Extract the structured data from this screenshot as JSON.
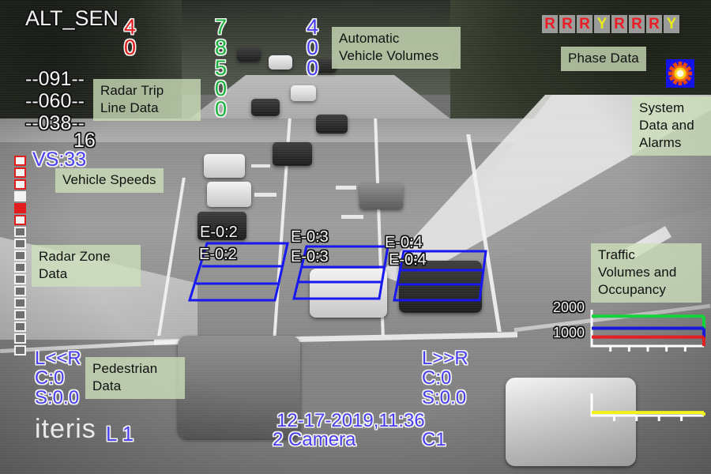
{
  "header": {
    "sensor_name": "ALT_SEN",
    "brand": "iteris"
  },
  "radar_trip_line": {
    "label": "Radar Trip\nLine Data",
    "values": [
      "--091--",
      "--060--",
      "--038--"
    ],
    "extra_count": "16"
  },
  "vehicle_speeds": {
    "label": "Vehicle Speeds",
    "value": "VS:33"
  },
  "radar_zone": {
    "label": "Radar Zone\nData",
    "states": [
      "red-open",
      "red-open",
      "red-open",
      "white",
      "red-fill",
      "red-open",
      "gray",
      "gray",
      "gray",
      "gray",
      "gray",
      "gray",
      "gray",
      "gray",
      "gray",
      "gray",
      "gray"
    ]
  },
  "automatic_vehicle_volumes": {
    "label": "Automatic\nVehicle Volumes",
    "columns": [
      {
        "color": "#e01b1b",
        "digits": [
          "4",
          "0"
        ]
      },
      {
        "color": "#17b23a",
        "digits": [
          "7",
          "8",
          "5",
          "0",
          "0"
        ]
      },
      {
        "color": "#4a3ff0",
        "digits": [
          "4",
          "0",
          "0"
        ]
      }
    ]
  },
  "phase_data": {
    "label": "Phase Data",
    "phases": [
      "R",
      "R",
      "R",
      "Y",
      "R",
      "R",
      "R",
      "Y"
    ]
  },
  "system_data": {
    "label": "System\nData and\nAlarms",
    "alarm_icon": "sun-alarm-icon"
  },
  "detection_zones": {
    "zones": [
      {
        "top_label": "E-0:2",
        "inner_label": "E-0:2"
      },
      {
        "top_label": "E-0:3",
        "inner_label": "E-0:3"
      },
      {
        "top_label": "E-0:4",
        "inner_label": "E-0:4"
      }
    ]
  },
  "pedestrian_left": {
    "label": "Pedestrian\nData",
    "direction": "L<<R",
    "count": "C:0",
    "speed": "S:0.0"
  },
  "pedestrian_right": {
    "direction": "L>>R",
    "count": "C:0",
    "speed": "S:0.0"
  },
  "footer": {
    "timestamp": "12-17-2019,11:36",
    "camera": "2 Camera",
    "channel": "C1",
    "lane": "L 1"
  },
  "traffic_panel": {
    "label": "Traffic\nVolumes and\nOccupancy"
  },
  "chart_data": [
    {
      "type": "line",
      "title": "Traffic Volumes and Occupancy",
      "ytick_labels": [
        "2000",
        "1000"
      ],
      "ylim": [
        0,
        2500
      ],
      "grid": false,
      "legend": "none",
      "x": [
        0,
        1,
        2,
        3,
        4,
        5
      ],
      "series": [
        {
          "name": "volume-green",
          "color": "#12d43a",
          "values": [
            2050,
            2050,
            2050,
            2050,
            2050,
            2050
          ]
        },
        {
          "name": "volume-blue",
          "color": "#1a18d8",
          "values": [
            1220,
            1220,
            1220,
            1220,
            1220,
            1220
          ]
        },
        {
          "name": "volume-red",
          "color": "#e41f1f",
          "values": [
            620,
            620,
            620,
            620,
            620,
            620
          ]
        }
      ],
      "xtick_count": 5
    },
    {
      "type": "line",
      "title": "Occupancy",
      "ytick_labels": [],
      "ylim": [
        0,
        100
      ],
      "grid": false,
      "legend": "none",
      "x": [
        0,
        1,
        2,
        3,
        4,
        5
      ],
      "series": [
        {
          "name": "occupancy-yellow",
          "color": "#f2f21a",
          "values": [
            14,
            14,
            14,
            14,
            14,
            14
          ]
        }
      ],
      "xtick_count": 4
    }
  ]
}
